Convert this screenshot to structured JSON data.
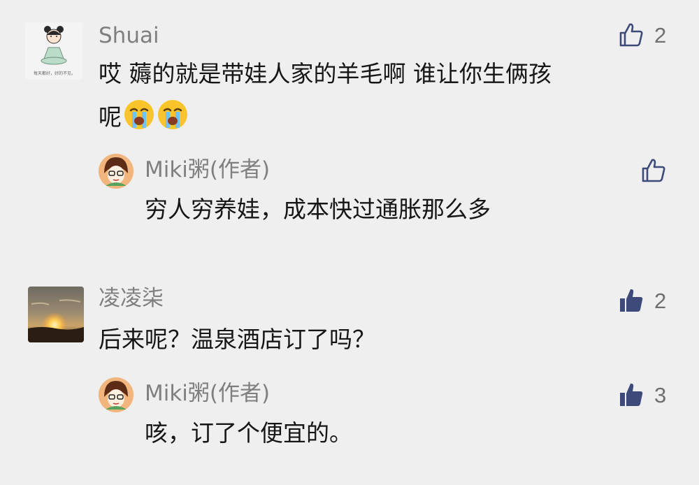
{
  "comments": [
    {
      "username": "Shuai",
      "text_line1": "哎 薅的就是带娃人家的羊毛啊 谁让你生俩孩",
      "text_line2": "呢",
      "emoji": [
        "loudly-crying-face-emoji",
        "loudly-crying-face-emoji"
      ],
      "likes": "2",
      "liked": false,
      "avatar_caption": "每天都好，好的不见。",
      "reply": {
        "username": "Miki粥(作者)",
        "text": "穷人穷养娃，成本快过通胀那么多",
        "likes": "",
        "liked": false
      }
    },
    {
      "username": "凌凌柒",
      "text": "后来呢？温泉酒店订了吗？",
      "likes": "2",
      "liked": true,
      "reply": {
        "username": "Miki粥(作者)",
        "text": "咳，订了个便宜的。",
        "likes": "3",
        "liked": true
      }
    }
  ],
  "colors": {
    "background": "#efefef",
    "username": "#7f7f7f",
    "text": "#161616",
    "like_outline": "#3e4a79",
    "like_filled": "#3e4a79"
  }
}
